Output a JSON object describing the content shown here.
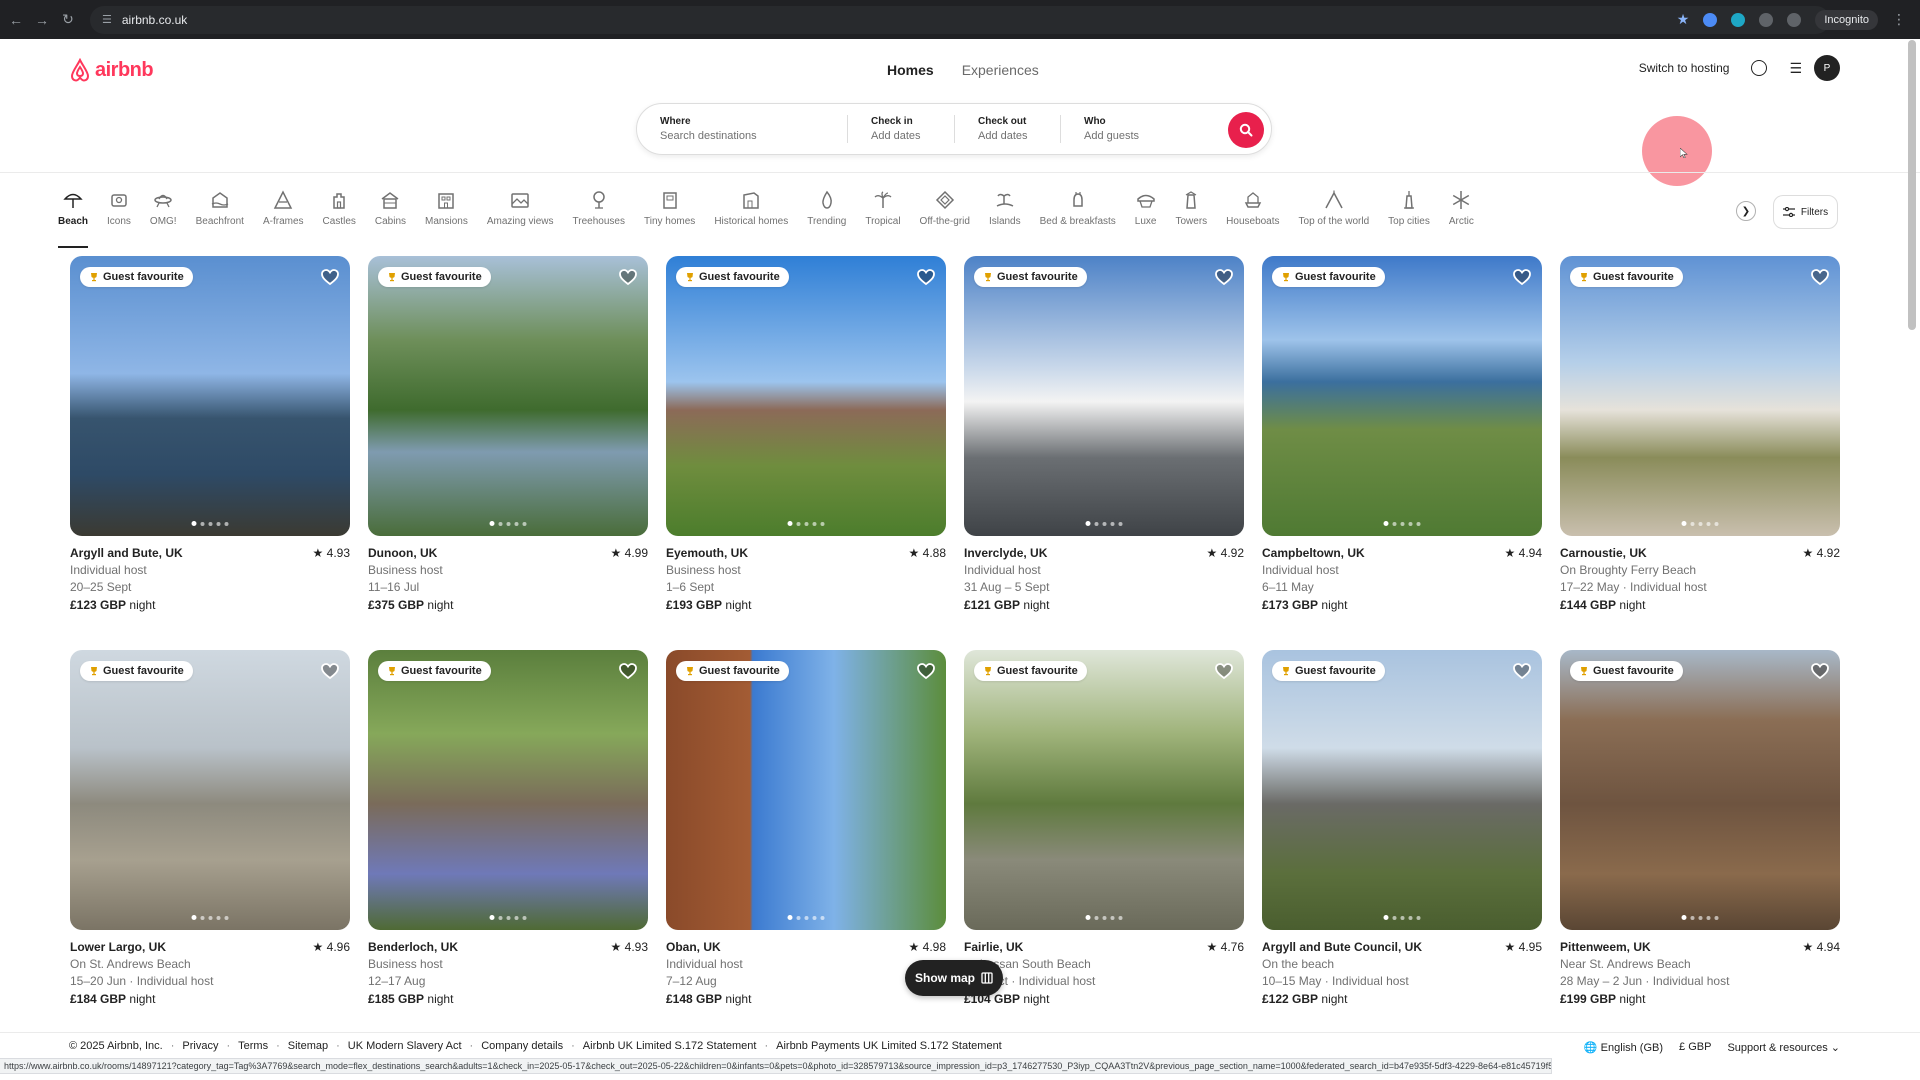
{
  "browser": {
    "url": "airbnb.co.uk",
    "incognito_label": "Incognito"
  },
  "header": {
    "logo_text": "airbnb",
    "tabs": [
      {
        "label": "Homes",
        "active": true
      },
      {
        "label": "Experiences",
        "active": false
      }
    ],
    "switch_to_hosting": "Switch to hosting",
    "avatar_initial": "P"
  },
  "search": {
    "where_label": "Where",
    "where_placeholder": "Search destinations",
    "checkin_label": "Check in",
    "checkin_value": "Add dates",
    "checkout_label": "Check out",
    "checkout_value": "Add dates",
    "who_label": "Who",
    "who_value": "Add guests"
  },
  "categories": [
    {
      "label": "Beach",
      "icon": "beach-umbrella-icon",
      "active": true
    },
    {
      "label": "Icons",
      "icon": "icons-bell-icon"
    },
    {
      "label": "OMG!",
      "icon": "ufo-house-icon"
    },
    {
      "label": "Beachfront",
      "icon": "beachfront-icon"
    },
    {
      "label": "A-frames",
      "icon": "a-frame-icon"
    },
    {
      "label": "Castles",
      "icon": "castle-icon"
    },
    {
      "label": "Cabins",
      "icon": "cabin-icon"
    },
    {
      "label": "Mansions",
      "icon": "mansion-icon"
    },
    {
      "label": "Amazing views",
      "icon": "amazing-views-icon"
    },
    {
      "label": "Treehouses",
      "icon": "treehouse-icon"
    },
    {
      "label": "Tiny homes",
      "icon": "tiny-home-icon"
    },
    {
      "label": "Historical homes",
      "icon": "historical-home-icon"
    },
    {
      "label": "Trending",
      "icon": "flame-icon"
    },
    {
      "label": "Tropical",
      "icon": "palm-icon"
    },
    {
      "label": "Off-the-grid",
      "icon": "off-grid-icon"
    },
    {
      "label": "Islands",
      "icon": "island-icon"
    },
    {
      "label": "Bed & breakfasts",
      "icon": "bed-breakfast-icon"
    },
    {
      "label": "Luxe",
      "icon": "luxe-icon"
    },
    {
      "label": "Towers",
      "icon": "tower-icon"
    },
    {
      "label": "Houseboats",
      "icon": "houseboat-icon"
    },
    {
      "label": "Top of the world",
      "icon": "mountain-peak-icon"
    },
    {
      "label": "Top cities",
      "icon": "city-tower-icon"
    },
    {
      "label": "Arctic",
      "icon": "snowflake-icon"
    }
  ],
  "filters_label": "Filters",
  "badge_label": "Guest favourite",
  "listings": [
    {
      "location": "Argyll and Bute, UK",
      "rating": "★ 4.93",
      "line1": "Individual host",
      "line2": "20–25 Sept",
      "price": "£123 GBP",
      "unit": "night"
    },
    {
      "location": "Dunoon, UK",
      "rating": "★ 4.99",
      "line1": "Business host",
      "line2": "11–16 Jul",
      "price": "£375 GBP",
      "unit": "night"
    },
    {
      "location": "Eyemouth, UK",
      "rating": "★ 4.88",
      "line1": "Business host",
      "line2": "1–6 Sept",
      "price": "£193 GBP",
      "unit": "night"
    },
    {
      "location": "Inverclyde, UK",
      "rating": "★ 4.92",
      "line1": "Individual host",
      "line2": "31 Aug – 5 Sept",
      "price": "£121 GBP",
      "unit": "night"
    },
    {
      "location": "Campbeltown, UK",
      "rating": "★ 4.94",
      "line1": "Individual host",
      "line2": "6–11 May",
      "price": "£173 GBP",
      "unit": "night"
    },
    {
      "location": "Carnoustie, UK",
      "rating": "★ 4.92",
      "line1": "On Broughty Ferry Beach",
      "line2": "17–22 May · Individual host",
      "price": "£144 GBP",
      "unit": "night"
    },
    {
      "location": "Lower Largo, UK",
      "rating": "★ 4.96",
      "line1": "On St. Andrews Beach",
      "line2": "15–20 Jun · Individual host",
      "price": "£184 GBP",
      "unit": "night"
    },
    {
      "location": "Benderloch, UK",
      "rating": "★ 4.93",
      "line1": "Business host",
      "line2": "12–17 Aug",
      "price": "£185 GBP",
      "unit": "night"
    },
    {
      "location": "Oban, UK",
      "rating": "★ 4.98",
      "line1": "Individual host",
      "line2": "7–12 Aug",
      "price": "£148 GBP",
      "unit": "night"
    },
    {
      "location": "Fairlie, UK",
      "rating": "★ 4.76",
      "line1": "…drossan South Beach",
      "line2": "… 5 Oct · Individual host",
      "price": "£104 GBP",
      "unit": "night"
    },
    {
      "location": "Argyll and Bute Council, UK",
      "rating": "★ 4.95",
      "line1": "On the beach",
      "line2": "10–15 May · Individual host",
      "price": "£122 GBP",
      "unit": "night"
    },
    {
      "location": "Pittenweem, UK",
      "rating": "★ 4.94",
      "line1": "Near St. Andrews Beach",
      "line2": "28 May – 2 Jun · Individual host",
      "price": "£199 GBP",
      "unit": "night"
    }
  ],
  "show_map_label": "Show map",
  "footer": {
    "copyright": "© 2025 Airbnb, Inc.",
    "links": [
      "Privacy",
      "Terms",
      "Sitemap",
      "UK Modern Slavery Act",
      "Company details",
      "Airbnb UK Limited S.172 Statement",
      "Airbnb Payments UK Limited S.172 Statement"
    ],
    "language": "English (GB)",
    "currency": "£  GBP",
    "support": "Support & resources"
  },
  "status_url": "https://www.airbnb.co.uk/rooms/14897121?category_tag=Tag%3A7769&search_mode=flex_destinations_search&adults=1&check_in=2025-05-17&check_out=2025-05-22&children=0&infants=0&pets=0&photo_id=328579713&source_impression_id=p3_1746277530_P3iyp_CQAA3Ttn2V&previous_page_section_name=1000&federated_search_id=b47e935f-5df3-4229-8e64-e81c45719f54",
  "colors": {
    "brand": "#ff385c",
    "search_button": "#e8204c"
  }
}
